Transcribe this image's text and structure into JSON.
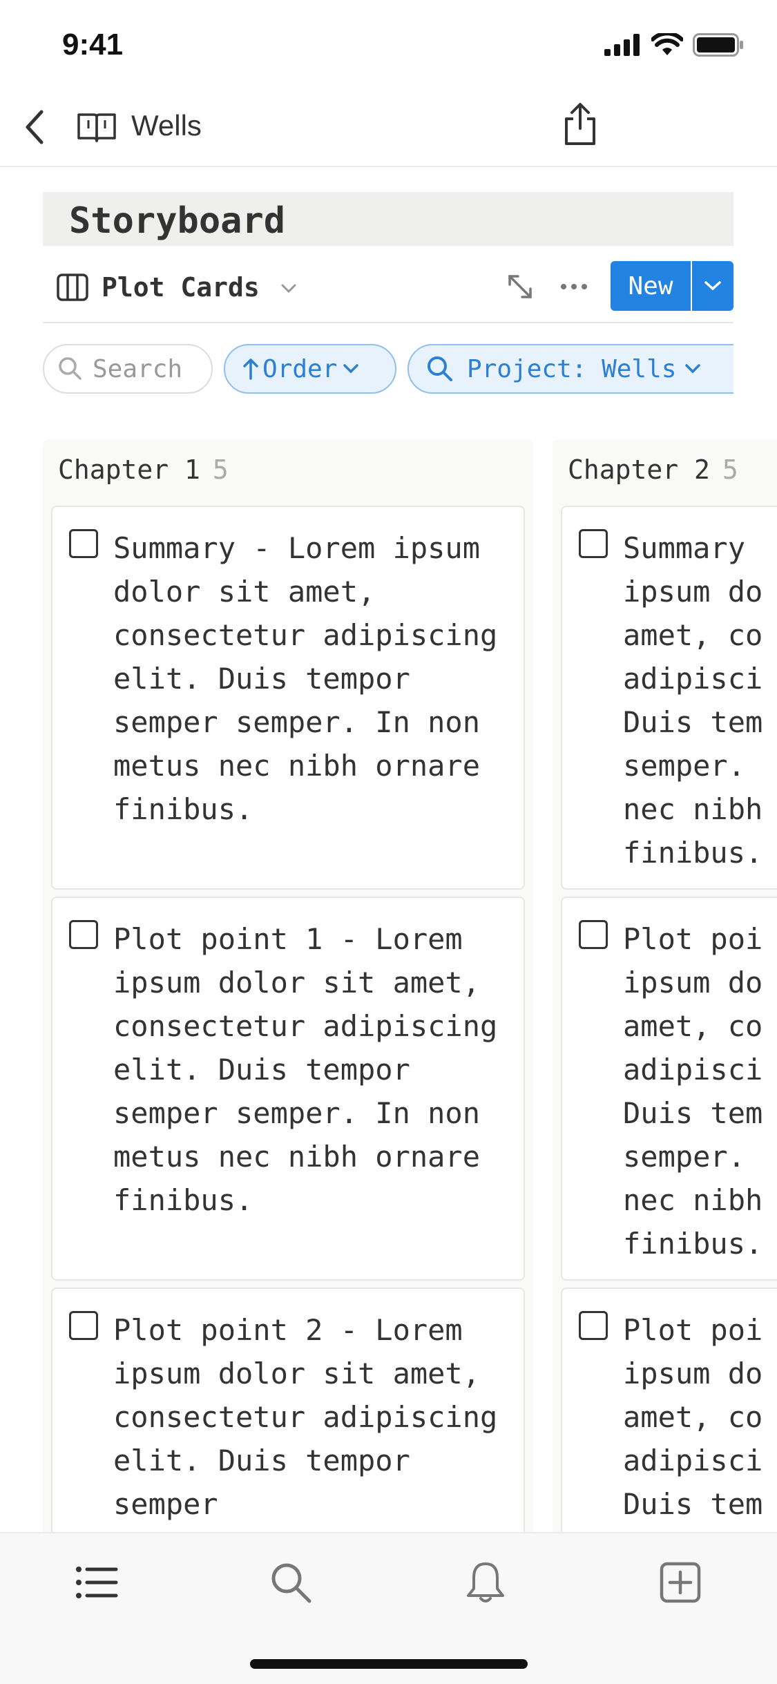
{
  "status": {
    "time": "9:41"
  },
  "nav": {
    "title": "Wells"
  },
  "board": {
    "title": "Storyboard",
    "view_name": "Plot Cards",
    "new_label": "New"
  },
  "filters": {
    "search_placeholder": "Search",
    "order_label": "Order",
    "project_label": "Project: Wells"
  },
  "columns": [
    {
      "name": "Chapter 1",
      "count": "5",
      "cards": [
        {
          "text": "Summary - Lorem ipsum dolor sit amet, consectetur adipiscing elit. Duis tempor semper semper. In non metus nec nibh ornare finibus."
        },
        {
          "text": "Plot point 1 - Lorem ipsum dolor sit amet, consectetur adipiscing elit. Duis tempor semper semper. In non metus nec nibh ornare finibus."
        },
        {
          "text": "Plot point 2 - Lorem ipsum dolor sit amet, consectetur adipiscing elit. Duis tempor semper"
        }
      ]
    },
    {
      "name": "Chapter 2",
      "count": "5",
      "cards": [
        {
          "text": "Summary ipsum do amet, co adipisci Duis tem semper. nec nibh finibus."
        },
        {
          "text": "Plot poi ipsum do amet, co adipisci Duis tem semper. nec nibh finibus."
        },
        {
          "text": "Plot poi ipsum do amet, co adipisci Duis tem"
        }
      ]
    }
  ],
  "colors": {
    "accent": "#2383e2",
    "filter_bg": "#e8f2fc",
    "text": "#2f2f2f"
  },
  "tabbar": {
    "icons": [
      "list-icon",
      "search-icon",
      "bell-icon",
      "add-square-icon"
    ]
  }
}
